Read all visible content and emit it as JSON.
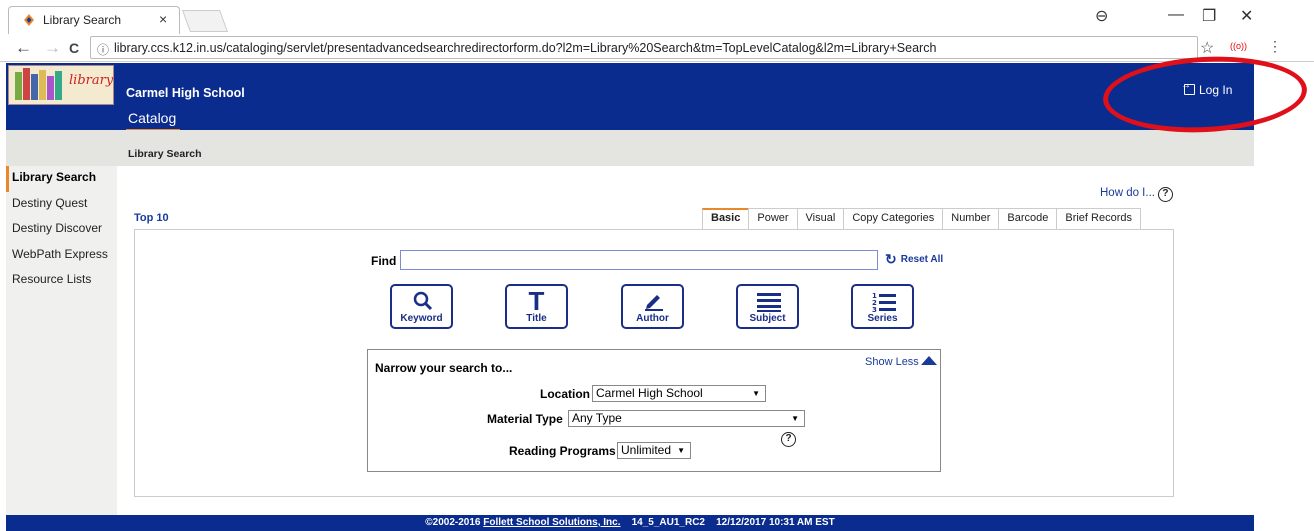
{
  "browser": {
    "tab_title": "Library Search",
    "tab_close": "×",
    "url": "library.ccs.k12.in.us/cataloging/servlet/presentadvancedsearchredirectorform.do?l2m=Library%20Search&tm=TopLevelCatalog&l2m=Library+Search",
    "info_icon": "ⓘ",
    "back": "←",
    "forward": "→",
    "reload": "C",
    "star": "☆",
    "ext": "((o))",
    "menu": "⋮",
    "account": "⊖",
    "minimize": "—",
    "restore": "❐",
    "close": "✕"
  },
  "header": {
    "logo_text": "library",
    "school": "Carmel High School",
    "catalog_tab": "Catalog",
    "login_label": "Log In"
  },
  "breadcrumb": "Library Search",
  "sidebar": {
    "items": [
      {
        "label": "Library Search"
      },
      {
        "label": "Destiny Quest"
      },
      {
        "label": "Destiny Discover"
      },
      {
        "label": "WebPath Express"
      },
      {
        "label": "Resource Lists"
      }
    ]
  },
  "howdo": "How do I...",
  "help_glyph": "?",
  "top10": "Top 10",
  "search_tabs": [
    {
      "label": "Basic"
    },
    {
      "label": "Power"
    },
    {
      "label": "Visual"
    },
    {
      "label": "Copy Categories"
    },
    {
      "label": "Number"
    },
    {
      "label": "Barcode"
    },
    {
      "label": "Brief Records"
    }
  ],
  "find": {
    "label": "Find",
    "value": "",
    "reset_label": "Reset All",
    "reset_icon": "↻"
  },
  "search_buttons": [
    {
      "label": "Keyword",
      "icon": "search-icon",
      "glyph": "🔍︎"
    },
    {
      "label": "Title",
      "icon": "title-t-icon",
      "glyph": "T"
    },
    {
      "label": "Author",
      "icon": "pencil-icon",
      "glyph": "✎"
    },
    {
      "label": "Subject",
      "icon": "lines-icon",
      "glyph": "☰"
    },
    {
      "label": "Series",
      "icon": "numbered-list-icon",
      "glyph": "☷"
    }
  ],
  "narrow": {
    "title": "Narrow your search to...",
    "show_less": "Show Less",
    "location_label": "Location",
    "location_value": "Carmel High School",
    "material_label": "Material Type",
    "material_value": "Any Type",
    "reading_label": "Reading Programs",
    "reading_value": "Unlimited",
    "dropdown_arrow": "▼"
  },
  "footer": {
    "copyright": "©2002-2016",
    "company": "Follett School Solutions, Inc.",
    "version": "14_5_AU1_RC2",
    "datetime": "12/12/2017 10:31 AM EST"
  },
  "colors": {
    "header_blue": "#0a2c8e",
    "accent_orange": "#e8882a",
    "annotation_red": "#e0101a"
  }
}
